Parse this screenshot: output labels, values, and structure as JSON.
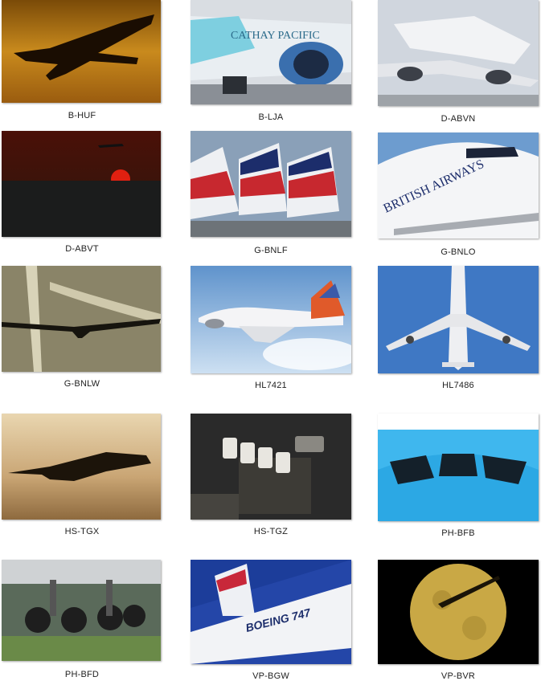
{
  "gallery": {
    "items": [
      {
        "label": "B-HUF"
      },
      {
        "label": "B-LJA"
      },
      {
        "label": "D-ABVN"
      },
      {
        "label": "D-ABVT"
      },
      {
        "label": "G-BNLF"
      },
      {
        "label": "G-BNLO"
      },
      {
        "label": "G-BNLW"
      },
      {
        "label": "HL7421"
      },
      {
        "label": "HL7486"
      },
      {
        "label": "HS-TGX"
      },
      {
        "label": "HS-TGZ"
      },
      {
        "label": "PH-BFB"
      },
      {
        "label": "PH-BFD"
      },
      {
        "label": "VP-BGW"
      },
      {
        "label": "VP-BVR"
      }
    ]
  }
}
